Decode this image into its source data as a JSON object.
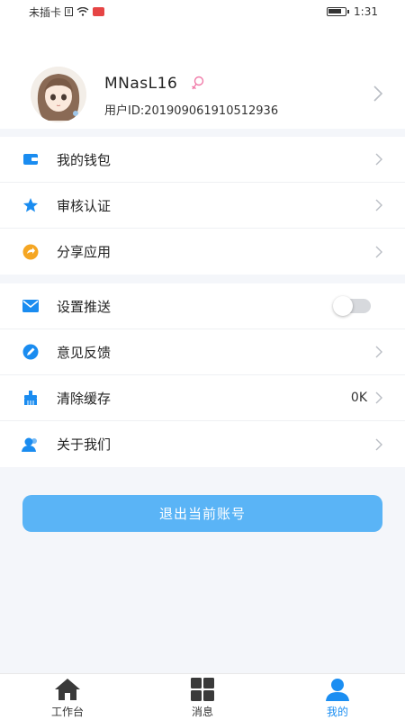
{
  "status_bar": {
    "carrier": "未插卡",
    "time": "1:31"
  },
  "profile": {
    "username": "MNasL16",
    "user_id": "用户ID:201909061910512936"
  },
  "menu_group_1": [
    {
      "label": "我的钱包",
      "icon": "wallet-icon"
    },
    {
      "label": "审核认证",
      "icon": "star-icon"
    },
    {
      "label": "分享应用",
      "icon": "share-icon"
    }
  ],
  "menu_group_2": [
    {
      "label": "设置推送",
      "icon": "mail-icon",
      "toggle": false
    },
    {
      "label": "意见反馈",
      "icon": "feedback-icon"
    },
    {
      "label": "清除缓存",
      "icon": "clear-cache-icon",
      "value": "0K"
    },
    {
      "label": "关于我们",
      "icon": "about-icon"
    }
  ],
  "logout_label": "退出当前账号",
  "tabs": [
    {
      "label": "工作台",
      "icon": "home-icon",
      "active": false
    },
    {
      "label": "消息",
      "icon": "grid-icon",
      "active": false
    },
    {
      "label": "我的",
      "icon": "user-icon",
      "active": true
    }
  ],
  "colors": {
    "accent": "#1b8ef2",
    "button": "#5ab4f6",
    "icon_blue": "#1a8cf0",
    "icon_orange": "#f5a623",
    "background": "#f4f6fa"
  }
}
